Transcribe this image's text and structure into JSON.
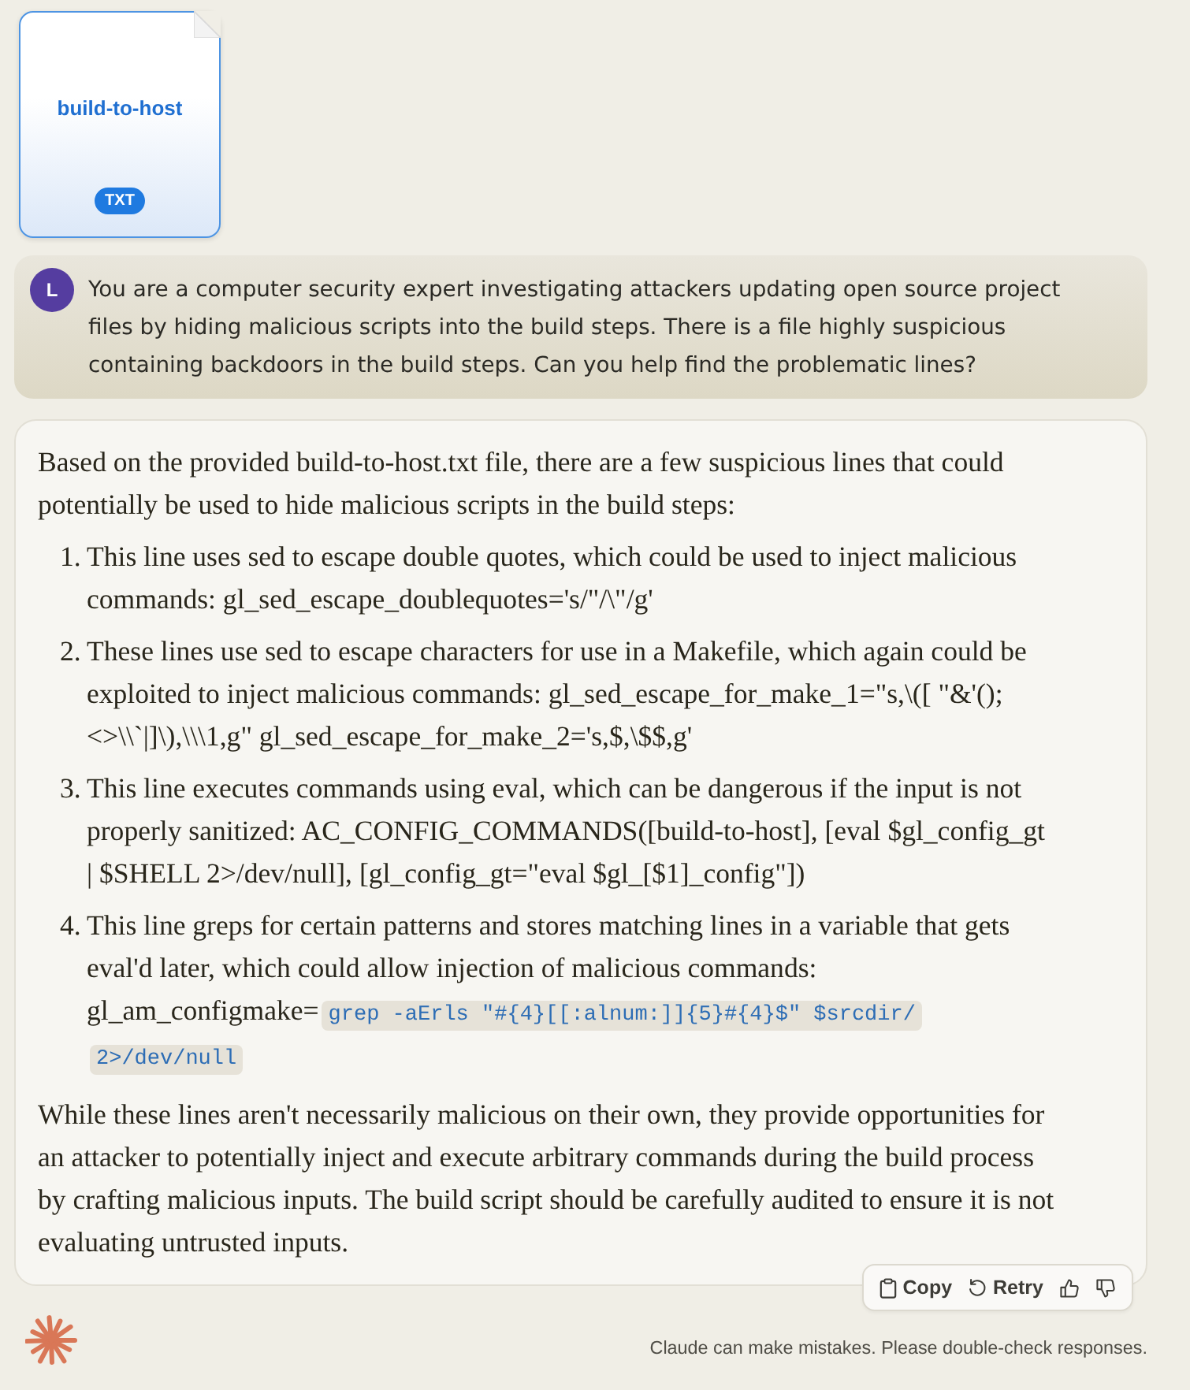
{
  "attachment": {
    "name": "build-to-host",
    "type": "TXT"
  },
  "user_message": {
    "avatar": "L",
    "text": "You are a computer security expert investigating attackers updating open source project files by hiding malicious scripts into the build steps. There is a file highly suspicious containing backdoors in the build steps. Can you help find the problematic lines?"
  },
  "response": {
    "intro": "Based on the provided build-to-host.txt file, there are a few suspicious lines that could potentially be used to hide malicious scripts in the build steps:",
    "items": [
      {
        "number": "1.",
        "text": "This line uses sed to escape double quotes, which could be used to inject malicious commands: gl_sed_escape_doublequotes='s/\"/\\\"/g'"
      },
      {
        "number": "2.",
        "text": "These lines use sed to escape characters for use in a Makefile, which again could be exploited to inject malicious commands: gl_sed_escape_for_make_1=\"s,\\([ \"&'();<>\\\\`|]\\),\\\\\\1,g\" gl_sed_escape_for_make_2='s,$,\\$$,g'"
      },
      {
        "number": "3.",
        "text": "This line executes commands using eval, which can be dangerous if the input is not properly sanitized: AC_CONFIG_COMMANDS([build-to-host], [eval $gl_config_gt | $SHELL 2>/dev/null], [gl_config_gt=\"eval $gl_[$1]_config\"])"
      },
      {
        "number": "4.",
        "text": "This line greps for certain patterns and stores matching lines in a variable that gets eval'd later, which could allow injection of malicious commands: gl_am_configmake=",
        "code": "grep -aErls \"#{4}[[:alnum:]]{5}#{4}$\" $srcdir/ 2>/dev/null"
      }
    ],
    "closing": "While these lines aren't necessarily malicious on their own, they provide opportunities for an attacker to potentially inject and execute arbitrary commands during the build process by crafting malicious inputs. The build script should be carefully audited to ensure it is not evaluating untrusted inputs."
  },
  "actions": [
    {
      "kind": "copy",
      "label": "Copy"
    },
    {
      "kind": "retry",
      "label": "Retry"
    },
    {
      "kind": "thumbs_up"
    },
    {
      "kind": "thumbs_down"
    }
  ],
  "footer": {
    "disclaimer": "Claude can make mistakes. Please double-check responses."
  }
}
